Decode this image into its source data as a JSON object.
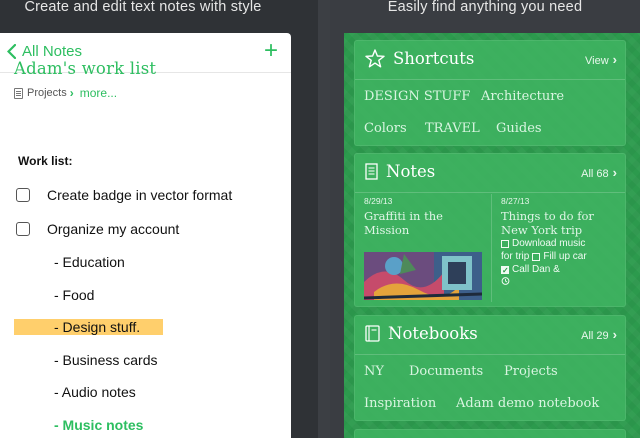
{
  "left": {
    "caption": "Create and edit text notes with style",
    "nav": {
      "back_label": "All Notes",
      "add_label": "+"
    },
    "note": {
      "title": "Adam's work list",
      "notebook": "Projects",
      "more": "more...",
      "heading": "Work list:",
      "items": [
        {
          "text": "Create badge in vector format",
          "checkbox": true
        },
        {
          "text": "Organize my account",
          "checkbox": true
        },
        {
          "text": "- Education",
          "checkbox": false
        },
        {
          "text": "- Food",
          "checkbox": false
        },
        {
          "text": "- Design stuff.",
          "checkbox": false,
          "highlighted": true
        },
        {
          "text": "- Business cards",
          "checkbox": false
        },
        {
          "text": "- Audio notes",
          "checkbox": false
        },
        {
          "text": "- Music notes",
          "checkbox": false,
          "accent": true
        }
      ]
    }
  },
  "right": {
    "caption": "Easily find anything you need",
    "shortcuts": {
      "title": "Shortcuts",
      "link": "View",
      "tags": [
        "DESIGN STUFF",
        "Architecture",
        "Colors",
        "TRAVEL",
        "Guides"
      ]
    },
    "notes": {
      "title": "Notes",
      "link": "All 68",
      "items": [
        {
          "date": "8/29/13",
          "title_line1": "Graffiti in the",
          "title_line2": "Mission"
        },
        {
          "date": "8/27/13",
          "title_line1": "Things to do for",
          "title_line2": "New York trip",
          "lines": [
            "Download music",
            "for trip",
            "Fill up car",
            "Call Dan &"
          ]
        }
      ]
    },
    "notebooks": {
      "title": "Notebooks",
      "link": "All 29",
      "tags": [
        "NY",
        "Documents",
        "Projects",
        "Inspiration",
        "Adam demo notebook"
      ]
    }
  },
  "colors": {
    "accent": "#2dbe60",
    "highlight": "#ffcf6c",
    "green_bg": "#2c9a4d"
  },
  "icons": [
    "chevron-left-icon",
    "plus-icon",
    "notebook-icon",
    "star-icon",
    "note-icon",
    "notebooks-icon",
    "chevron-right-icon"
  ]
}
